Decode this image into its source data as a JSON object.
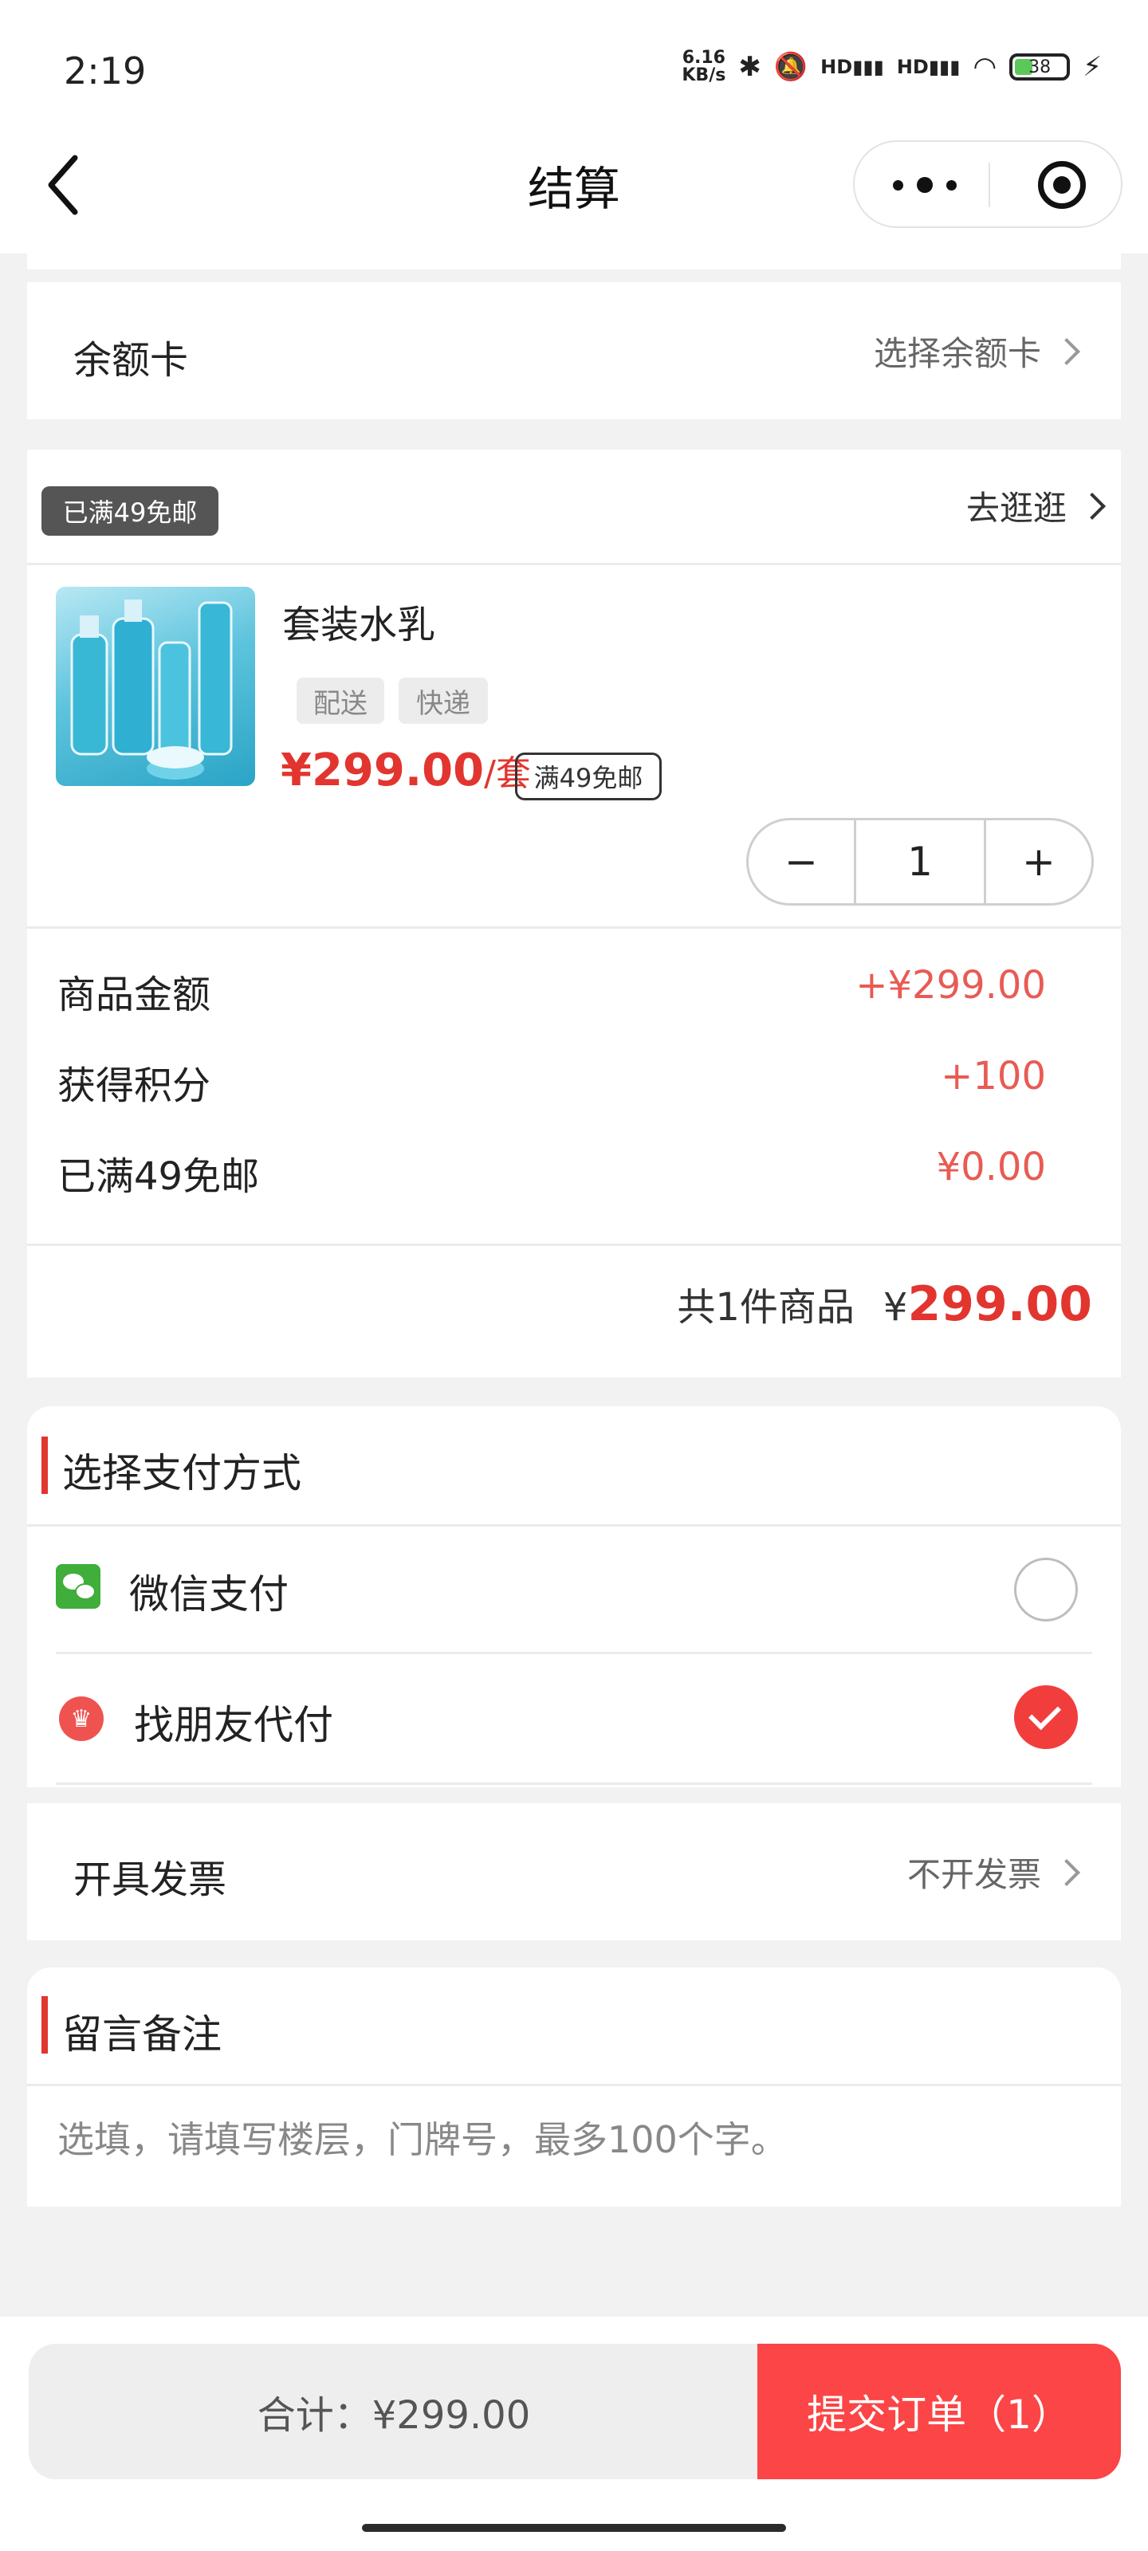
{
  "status_bar": {
    "time": "2:19",
    "speed_value": "6.16",
    "speed_unit": "KB/s",
    "battery": "38",
    "hd1": "HD",
    "hd2": "HD"
  },
  "nav": {
    "title": "结算",
    "back_icon": "chevron-left-icon",
    "more_icon": "more-dots-icon",
    "close_icon": "target-circle-icon"
  },
  "balance_card": {
    "label": "余额卡",
    "action": "选择余额卡"
  },
  "shop": {
    "free_shipping_tag": "已满49免邮",
    "go_shopping": "去逛逛"
  },
  "product": {
    "name": "套装水乳",
    "chips": [
      "配送",
      "快递"
    ],
    "price": "¥299.00",
    "unit": "/套",
    "badge": "满49免邮",
    "quantity": "1",
    "minus": "−",
    "plus": "+"
  },
  "summary": {
    "rows": [
      {
        "label": "商品金额",
        "value": "+¥299.00"
      },
      {
        "label": "获得积分",
        "value": "+100"
      },
      {
        "label": "已满49免邮",
        "value": "¥0.00"
      }
    ],
    "count_text": "共1件商品",
    "currency": "¥",
    "total_amount": "299.00"
  },
  "payment": {
    "title": "选择支付方式",
    "options": [
      {
        "label": "微信支付",
        "icon": "wechat-icon",
        "selected": false
      },
      {
        "label": "找朋友代付",
        "icon": "crown-icon",
        "selected": true
      }
    ]
  },
  "invoice": {
    "label": "开具发票",
    "value": "不开发票"
  },
  "note": {
    "title": "留言备注",
    "placeholder": "选填，请填写楼层，门牌号，最多100个字。"
  },
  "footer": {
    "total_text": "合计：¥299.00",
    "submit": "提交订单（1）"
  },
  "colors": {
    "accent": "#e2352f",
    "submit_bg": "#fb4546",
    "wechat_green": "#3fae3a"
  }
}
